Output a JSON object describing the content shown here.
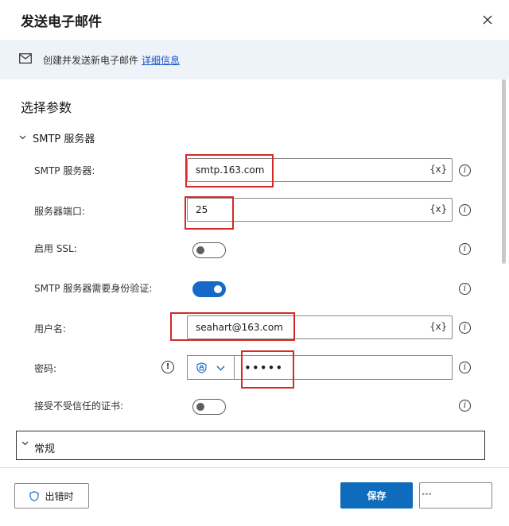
{
  "dialog": {
    "title": "发送电子邮件"
  },
  "info_bar": {
    "description": "创建并发送新电子邮件",
    "link": "详细信息"
  },
  "section_title": "选择参数",
  "smtp_group": {
    "header": "SMTP 服务器",
    "server": {
      "label": "SMTP 服务器:",
      "value": "smtp.163.com",
      "variable_button": "{x}"
    },
    "port": {
      "label": "服务器端口:",
      "value": "25",
      "variable_button": "{x}"
    },
    "ssl": {
      "label": "启用 SSL:",
      "enabled": false
    },
    "auth": {
      "label": "SMTP 服务器需要身份验证:",
      "enabled": true
    },
    "username": {
      "label": "用户名:",
      "value": "seahart@163.com",
      "variable_button": "{x}"
    },
    "password": {
      "label": "密码:",
      "masked_value": "•••••"
    },
    "untrusted_cert": {
      "label": "接受不受信任的证书:",
      "enabled": false
    }
  },
  "general_group": {
    "header": "常规"
  },
  "footer": {
    "on_error_label": "出错时",
    "save_label": "保存",
    "cancel_label": "",
    "watermark": "…"
  },
  "colors": {
    "accent": "#0f6cbd",
    "toggle_on": "#1769c9",
    "highlight_box": "#d42b27",
    "info_bar_bg": "#eef3fa"
  },
  "icons": [
    "close-icon",
    "mail-icon",
    "chevron-down-icon",
    "info-icon",
    "warning-icon",
    "shield-lock-icon",
    "shield-icon"
  ]
}
